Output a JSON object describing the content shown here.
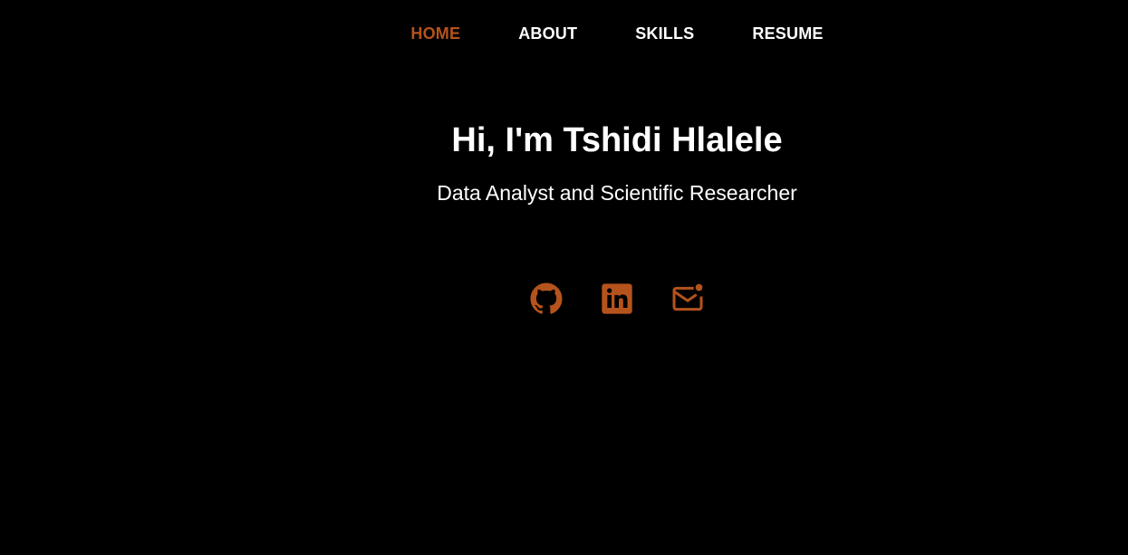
{
  "nav": {
    "items": [
      {
        "label": "HOME",
        "active": true
      },
      {
        "label": "ABOUT",
        "active": false
      },
      {
        "label": "SKILLS",
        "active": false
      },
      {
        "label": "RESUME",
        "active": false
      }
    ]
  },
  "hero": {
    "title": "Hi, I'm Tshidi Hlalele",
    "subtitle": "Data Analyst and Scientific Researcher"
  },
  "socials": {
    "icons": [
      "github-icon",
      "linkedin-icon",
      "email-icon"
    ]
  },
  "colors": {
    "background": "#000000",
    "text": "#ffffff",
    "accent": "#b5531c"
  }
}
